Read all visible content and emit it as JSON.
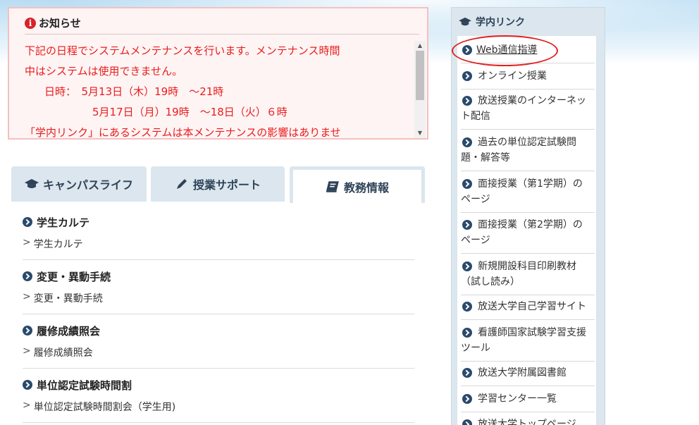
{
  "notice": {
    "title": "お知らせ",
    "lines": [
      "下記の日程でシステムメンテナンスを行います。メンテナンス時間",
      "中はシステムは使用できません。",
      "日時：　5月13日（木）19時　～21時",
      "5月17日（月）19時　～18日（火）６時",
      "「学内リンク」にあるシステムは本メンテナンスの影響はありませ"
    ]
  },
  "tabs": [
    {
      "label": "キャンパスライフ",
      "icon": "graduation-cap-icon"
    },
    {
      "label": "授業サポート",
      "icon": "pencil-icon"
    },
    {
      "label": "教務情報",
      "icon": "book-icon"
    }
  ],
  "sections": [
    {
      "title": "学生カルテ",
      "link": "学生カルテ"
    },
    {
      "title": "変更・異動手続",
      "link": "変更・異動手続"
    },
    {
      "title": "履修成績照会",
      "link": "履修成績照会"
    },
    {
      "title": "単位認定試験時間割",
      "link": "単位認定試験時間割会（学生用)"
    }
  ],
  "sidebar": {
    "title": "学内リンク",
    "items": [
      {
        "line1": "Web通信指導",
        "line2": ""
      },
      {
        "line1": "オンライン授業",
        "line2": ""
      },
      {
        "line1": "放送授業のインターネッ",
        "line2": "ト配信"
      },
      {
        "line1": "過去の単位認定試験問",
        "line2": "題・解答等"
      },
      {
        "line1": "面接授業（第1学期）の",
        "line2": "ページ"
      },
      {
        "line1": "面接授業（第2学期）の",
        "line2": "ページ"
      },
      {
        "line1": "新規開設科目印刷教材",
        "line2": "（試し読み）"
      },
      {
        "line1": "放送大学自己学習サイト",
        "line2": ""
      },
      {
        "line1": "看護師国家試験学習支援",
        "line2": "ツール"
      },
      {
        "line1": "放送大学附属図書館",
        "line2": ""
      },
      {
        "line1": "学習センター一覧",
        "line2": ""
      },
      {
        "line1": "放送大学トップページ",
        "line2": ""
      }
    ]
  },
  "link_prefix": "＞"
}
